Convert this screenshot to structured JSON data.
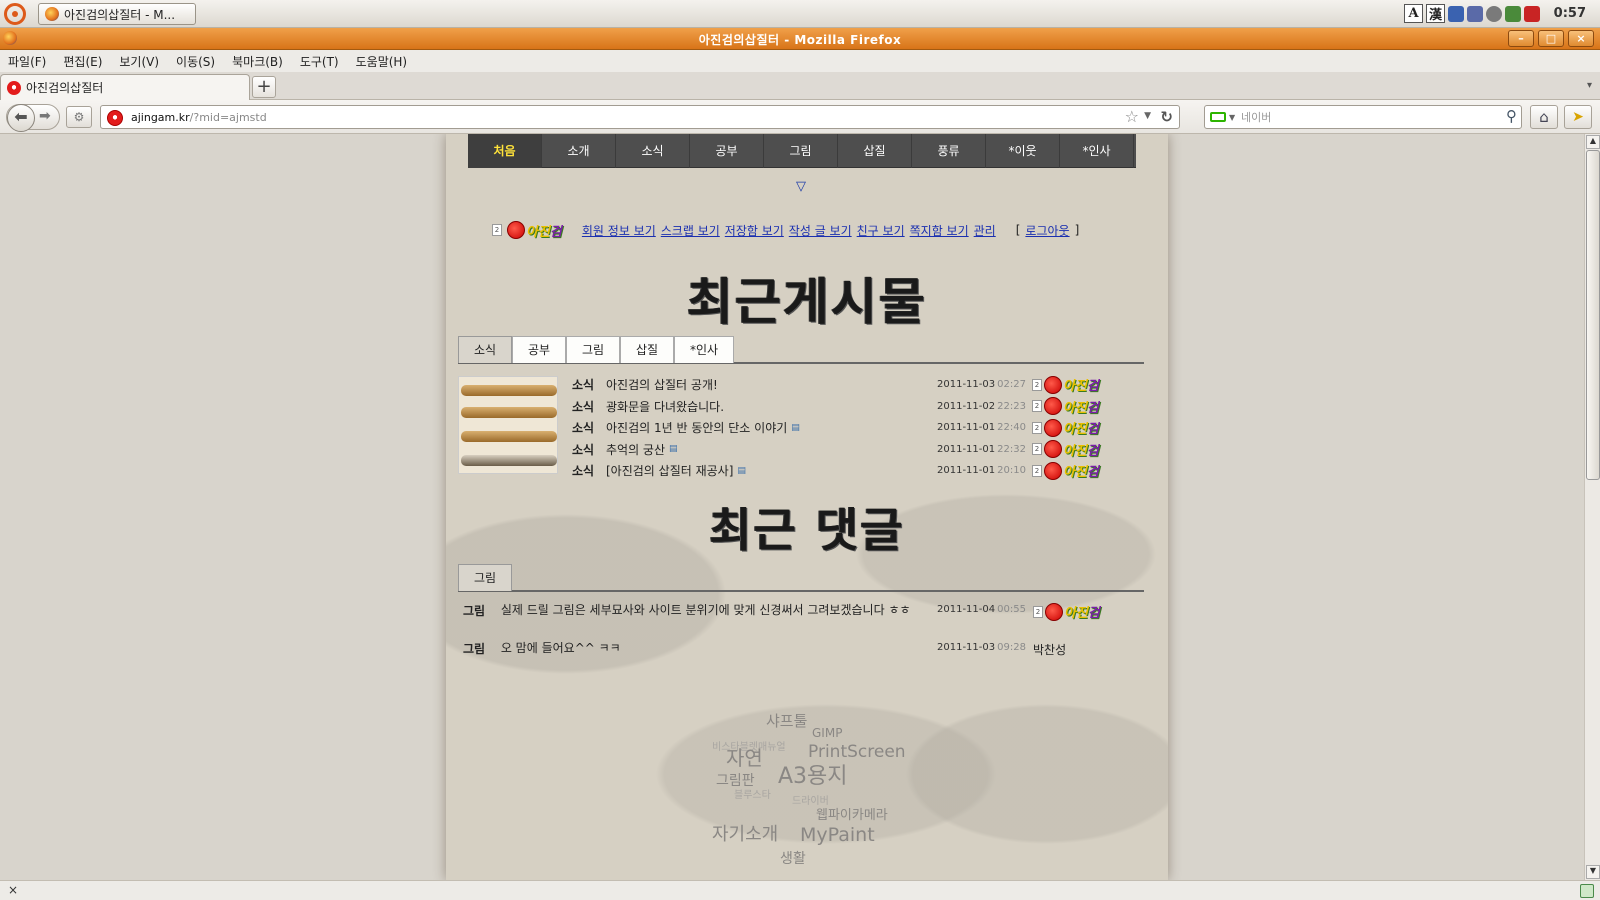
{
  "panel": {
    "taskbar_label": "아진검의삽질터 - M...",
    "tray_a": "A",
    "tray_han": "漢",
    "clock": "0:57"
  },
  "window": {
    "title": "아진검의삽질터 - Mozilla Firefox",
    "minimize": "–",
    "maximize": "□",
    "close": "×"
  },
  "menubar": [
    "파일(F)",
    "편집(E)",
    "보기(V)",
    "이동(S)",
    "북마크(B)",
    "도구(T)",
    "도움말(H)"
  ],
  "tabs": {
    "active_title": "아진검의삽질터",
    "new_tab": "+",
    "list_arrow": "▾"
  },
  "navbar": {
    "url_host": "ajingam.kr",
    "url_path": "/?mid=ajmstd",
    "search_placeholder": "네이버"
  },
  "site": {
    "nav": [
      "처음",
      "소개",
      "소식",
      "공부",
      "그림",
      "삽질",
      "풍류",
      "*이웃",
      "*인사"
    ],
    "drop_arrow": "▽",
    "member": {
      "name_prefix": "아진",
      "name_suffix": "검",
      "links": [
        "회원 정보 보기",
        "스크랩 보기",
        "저장함 보기",
        "작성 글 보기",
        "친구 보기",
        "쪽지함 보기",
        "관리"
      ],
      "bracket_open": "[",
      "logout": "로그아웃",
      "bracket_close": "]"
    },
    "recent_posts_heading": "최근게시물",
    "post_tabs": [
      "소식",
      "공부",
      "그림",
      "삽질",
      "*인사"
    ],
    "posts": [
      {
        "cat": "소식",
        "title": "아진검의 삽질터 공개!",
        "attach": false,
        "date": "2011-11-03",
        "time": "02:27"
      },
      {
        "cat": "소식",
        "title": "광화문을 다녀왔습니다.",
        "attach": false,
        "date": "2011-11-02",
        "time": "22:23"
      },
      {
        "cat": "소식",
        "title": "아진검의 1년 반 동안의 단소 이야기",
        "attach": true,
        "date": "2011-11-01",
        "time": "22:40"
      },
      {
        "cat": "소식",
        "title": "추억의 궁산",
        "attach": true,
        "date": "2011-11-01",
        "time": "22:32"
      },
      {
        "cat": "소식",
        "title": "[아진검의 삽질터 재공사]",
        "attach": true,
        "date": "2011-11-01",
        "time": "20:10"
      }
    ],
    "recent_comments_heading": "최근 댓글",
    "comment_tabs": [
      "그림"
    ],
    "comments": [
      {
        "cat": "그림",
        "text": "실제 드릴 그림은 세부묘사와 사이트 분위기에 맞게 신경써서 그려보겠습니다 ㅎㅎ",
        "date": "2011-11-04",
        "time": "00:55",
        "author": ""
      },
      {
        "cat": "그림",
        "text": "오 맘에 들어요^^ ㅋㅋ",
        "date": "2011-11-03",
        "time": "09:28",
        "author": "박찬성"
      }
    ],
    "tag_cloud": [
      {
        "text": "샤프툴",
        "size": 15
      },
      {
        "text": "GIMP",
        "size": 12
      },
      {
        "text": "비스타블렛매뉴얼",
        "size": 10
      },
      {
        "text": "자연",
        "size": 20
      },
      {
        "text": "PrintScreen",
        "size": 17
      },
      {
        "text": "A3용지",
        "size": 22
      },
      {
        "text": "그림판",
        "size": 14
      },
      {
        "text": "블루스타",
        "size": 10
      },
      {
        "text": "드라이버",
        "size": 10
      },
      {
        "text": "웹파이카메라",
        "size": 13
      },
      {
        "text": "자기소개",
        "size": 18
      },
      {
        "text": "MyPaint",
        "size": 19
      },
      {
        "text": "생활",
        "size": 14
      }
    ]
  },
  "statusbar": {
    "close": "×"
  },
  "icons": {
    "attach": "file-icon",
    "member": "member-badge-icon"
  }
}
